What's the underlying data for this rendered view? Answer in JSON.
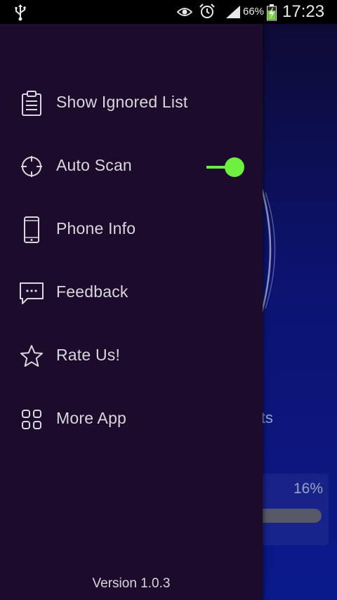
{
  "status_bar": {
    "battery": "66%",
    "time": "17:23"
  },
  "background_screen": {
    "threats_text": "reats",
    "progress_percent_text": "16%",
    "progress_value": 0.16
  },
  "drawer": {
    "menu_items": [
      {
        "label": "Show Ignored List",
        "icon": "clipboard-list-icon"
      },
      {
        "label": "Auto Scan",
        "icon": "crosshair-icon",
        "toggle_on": true
      },
      {
        "label": "Phone Info",
        "icon": "smartphone-icon"
      },
      {
        "label": "Feedback",
        "icon": "chat-bubble-icon"
      },
      {
        "label": "Rate Us!",
        "icon": "star-icon"
      },
      {
        "label": "More App",
        "icon": "grid-icon"
      }
    ],
    "version": "Version 1.0.3"
  },
  "colors": {
    "drawer_bg": "#1d0b2b",
    "toggle_accent": "#6ef03f",
    "text": "#d9d6df"
  }
}
